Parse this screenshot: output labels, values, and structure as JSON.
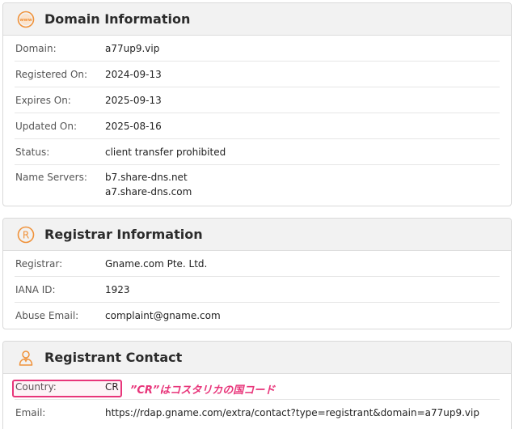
{
  "domain_info": {
    "title": "Domain Information",
    "icon": "www-icon",
    "rows": [
      {
        "label": "Domain:",
        "value": "a77up9.vip"
      },
      {
        "label": "Registered On:",
        "value": "2024-09-13"
      },
      {
        "label": "Expires On:",
        "value": "2025-09-13"
      },
      {
        "label": "Updated On:",
        "value": "2025-08-16"
      },
      {
        "label": "Status:",
        "value": "client transfer prohibited"
      }
    ],
    "name_servers": {
      "label": "Name Servers:",
      "values": [
        "b7.share-dns.net",
        "a7.share-dns.com"
      ]
    }
  },
  "registrar_info": {
    "title": "Registrar Information",
    "icon": "registered-icon",
    "rows": [
      {
        "label": "Registrar:",
        "value": "Gname.com Pte. Ltd."
      },
      {
        "label": "IANA ID:",
        "value": "1923"
      },
      {
        "label": "Abuse Email:",
        "value": "complaint@gname.com"
      }
    ]
  },
  "registrant_contact": {
    "title": "Registrant Contact",
    "icon": "person-icon",
    "rows": [
      {
        "label": "Country:",
        "value": "CR"
      },
      {
        "label": "Email:",
        "value": "https://rdap.gname.com/extra/contact?type=registrant&domain=a77up9.vip"
      }
    ]
  },
  "annotation": {
    "text": "”CR”はコスタリカの国コード",
    "color": "#e8357a"
  },
  "colors": {
    "icon_accent": "#f0923a",
    "header_bg": "#f2f2f2"
  }
}
